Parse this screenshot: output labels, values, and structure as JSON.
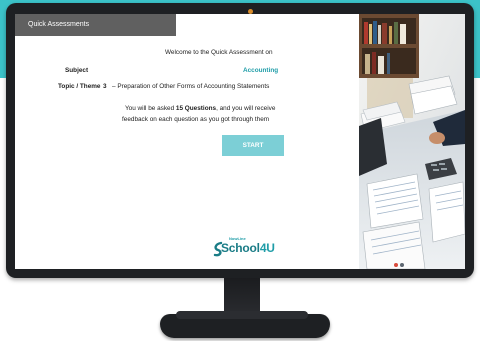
{
  "window": {
    "title": "Quick Assessments"
  },
  "assessment": {
    "welcome": "Welcome to the Quick Assessment on",
    "subject_label": "Subject",
    "subject_value": "Accounting",
    "topic_label": "Topic / Theme",
    "topic_number": "3",
    "topic_value": "– Preparation of Other Forms of Accounting Statements",
    "info_line1_prefix": "You will be asked ",
    "info_line1_bold": "15 Questions",
    "info_line1_suffix": ", and you will receive",
    "info_line2": "feedback on each question as you got through them",
    "start_label": "START"
  },
  "logo": {
    "tagline": "NowLine",
    "word": "School",
    "suffix": "4U"
  },
  "colors": {
    "teal_band": "#3cc3c9",
    "header_bg": "#606060",
    "accent": "#1f9da8",
    "start_button": "#7ccfd6"
  },
  "icons": [
    "camera-dot",
    "school4u-logo",
    "status-dots"
  ]
}
